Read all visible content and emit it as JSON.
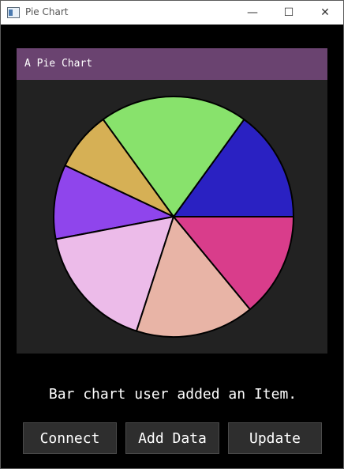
{
  "window": {
    "title": "Pie Chart",
    "controls": {
      "minimize": "—",
      "maximize": "☐",
      "close": "✕"
    }
  },
  "chart_panel": {
    "title": "A Pie Chart"
  },
  "chart_data": {
    "type": "pie",
    "title": "A Pie Chart",
    "slices": [
      {
        "value": 15,
        "color": "#2a21c2"
      },
      {
        "value": 20,
        "color": "#88e26c"
      },
      {
        "value": 8,
        "color": "#d6b055"
      },
      {
        "value": 10,
        "color": "#8f45ec"
      },
      {
        "value": 17,
        "color": "#ecbbe9"
      },
      {
        "value": 16,
        "color": "#e8b4a6"
      },
      {
        "value": 14,
        "color": "#d93d8b"
      }
    ]
  },
  "status": {
    "message": "Bar chart user added an Item."
  },
  "buttons": {
    "connect": "Connect",
    "add_data": "Add Data",
    "update": "Update"
  }
}
